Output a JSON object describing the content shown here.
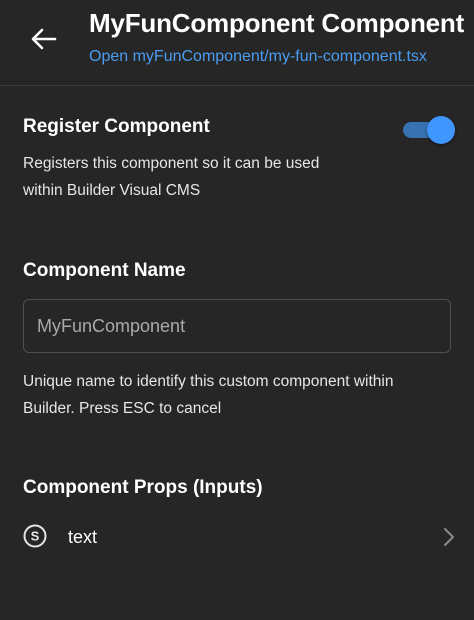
{
  "header": {
    "back_icon": "arrow-left-icon",
    "title": "MyFunComponent Component",
    "file_link": "Open myFunComponent/my-fun-component.tsx"
  },
  "register": {
    "title": "Register Component",
    "description_line1": "Registers this component so it can be used",
    "description_line2": "within Builder Visual CMS",
    "enabled": true
  },
  "component_name": {
    "title": "Component Name",
    "value": "MyFunComponent",
    "help_line1": "Unique name to identify this custom component within",
    "help_line2": "Builder. Press ESC to cancel"
  },
  "props": {
    "title": "Component Props (Inputs)",
    "items": [
      {
        "icon": "string-type-icon",
        "label": "text"
      }
    ]
  },
  "colors": {
    "background": "#262626",
    "accent": "#4096ff",
    "link": "#4a9df0"
  }
}
